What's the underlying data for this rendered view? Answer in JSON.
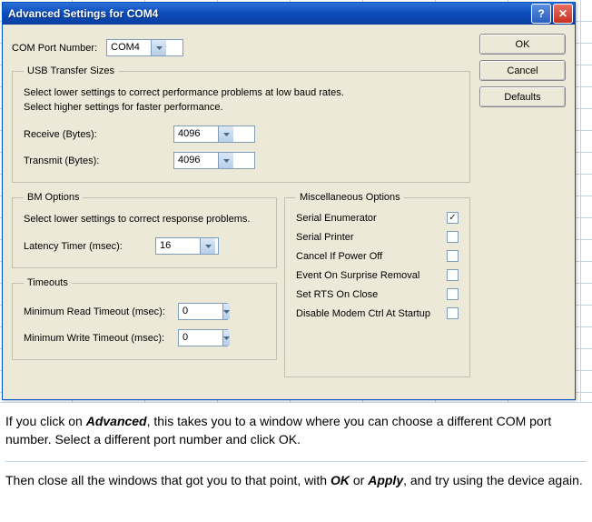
{
  "window": {
    "title": "Advanced Settings for COM4"
  },
  "buttons": {
    "ok": "OK",
    "cancel": "Cancel",
    "defaults": "Defaults"
  },
  "comPort": {
    "label": "COM Port Number:",
    "value": "COM4"
  },
  "usbTransfer": {
    "legend": "USB Transfer Sizes",
    "help1": "Select lower settings to correct performance problems at low baud rates.",
    "help2": "Select higher settings for faster performance.",
    "receiveLabel": "Receive (Bytes):",
    "receiveValue": "4096",
    "transmitLabel": "Transmit (Bytes):",
    "transmitValue": "4096"
  },
  "bmOptions": {
    "legend": "BM Options",
    "help": "Select lower settings to correct response problems.",
    "latencyLabel": "Latency Timer (msec):",
    "latencyValue": "16"
  },
  "timeouts": {
    "legend": "Timeouts",
    "minReadLabel": "Minimum Read Timeout (msec):",
    "minReadValue": "0",
    "minWriteLabel": "Minimum Write Timeout (msec):",
    "minWriteValue": "0"
  },
  "misc": {
    "legend": "Miscellaneous Options",
    "serialEnumerator": "Serial Enumerator",
    "serialPrinter": "Serial Printer",
    "cancelIfPowerOff": "Cancel If Power Off",
    "eventOnSurpriseRemoval": "Event On Surprise Removal",
    "setRtsOnClose": "Set RTS On Close",
    "disableModemCtrl": "Disable Modem Ctrl At Startup"
  },
  "instructions": {
    "p1a": "If you click on ",
    "p1advanced": "Advanced",
    "p1b": ", this takes you to a window where you can choose a different COM port number. Select a different port number and click OK.",
    "p2a": "Then close all the windows that got you to that point, with ",
    "p2ok": "OK",
    "p2b": " or ",
    "p2apply": "Apply",
    "p2c": ", and try using the device again."
  }
}
